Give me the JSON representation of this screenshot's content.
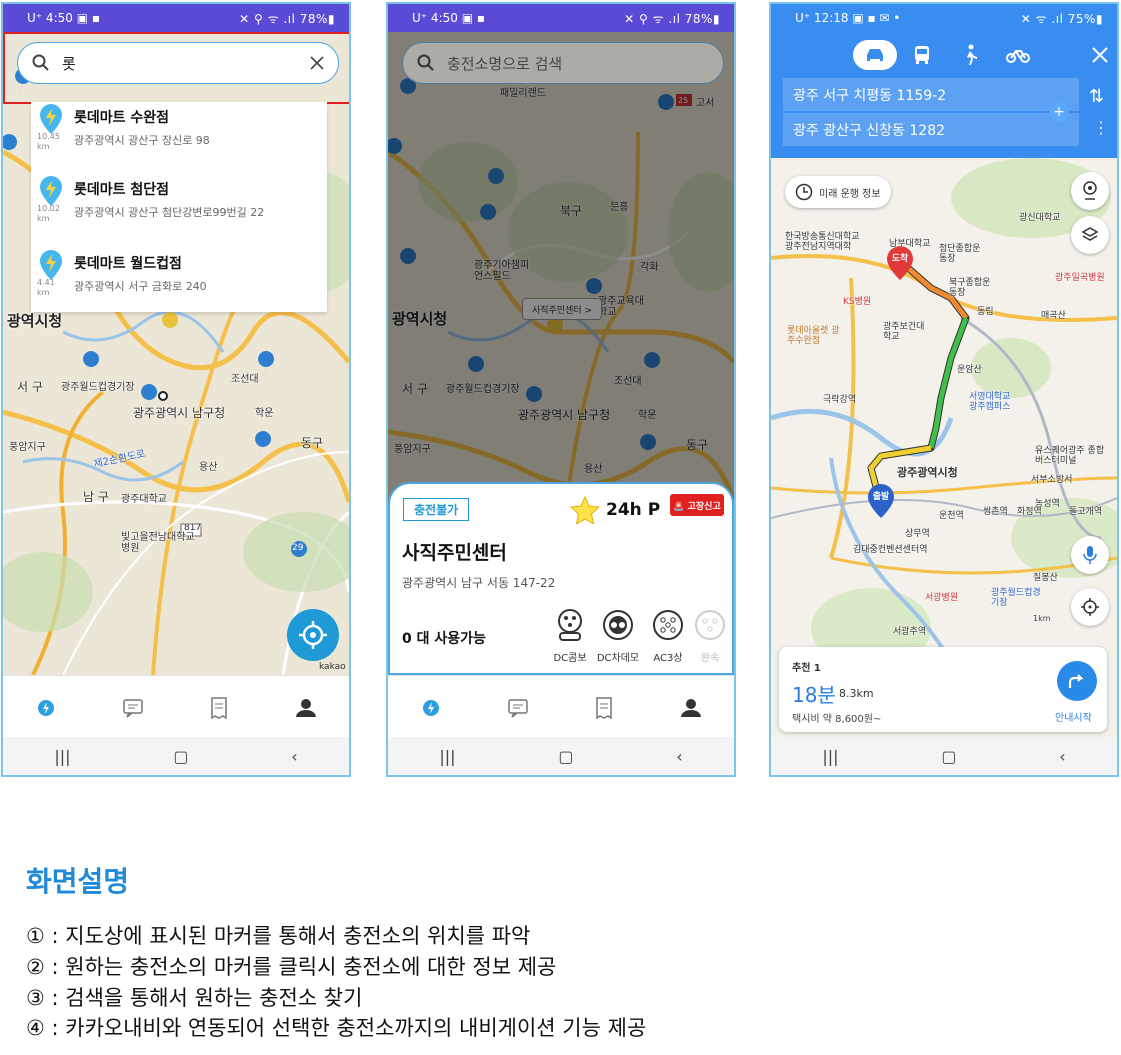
{
  "phone1": {
    "status": {
      "left": "U⁺ 4:50 ▣ ▪",
      "right": "✕ ⚲ ᯤ .ıl 78%▮"
    },
    "search": {
      "query": "롯"
    },
    "suggestions": [
      {
        "name": "롯데마트 수완점",
        "addr": "광주광역시 광산구 장신로 98",
        "dist": "10.45 km"
      },
      {
        "name": "롯데마트 첨단점",
        "addr": "광주광역시 광산구 첨단강변로99번길 22",
        "dist": "10.02 km"
      },
      {
        "name": "롯데마트 월드컵점",
        "addr": "광주광역시 서구 금화로 240",
        "dist": "4.41 km"
      }
    ],
    "map_labels": [
      "광역시청",
      "서 구",
      "광주월드컵경기장",
      "광주광역시 남구청",
      "조선대",
      "학운",
      "풍암지구",
      "동구",
      "용산",
      "남 구",
      "광주대학교",
      "빛고을전남대학교병원",
      "817",
      "29",
      "제2순환도로",
      "kakao"
    ]
  },
  "phone2": {
    "status": {
      "left": "U⁺ 4:50 ▣ ▪",
      "right": "✕ ⚲ ᯤ .ıl 78%▮"
    },
    "search": {
      "placeholder": "충전소명으로 검색"
    },
    "callout": "사직주민센터 >",
    "map_labels": [
      "패밀리랜드",
      "고서",
      "북구",
      "문흥",
      "각화",
      "광주기아챔피언스필드",
      "광주교육대학교",
      "광역시청",
      "서 구",
      "광주월드컵경기장",
      "광주광역시 남구청",
      "조선대",
      "학운",
      "풍암지구",
      "동구",
      "용산",
      "25"
    ],
    "card": {
      "status": "충전불가",
      "hours": "24h",
      "parking": "P",
      "fault": "🚨 고장신고",
      "name": "사직주민센터",
      "address": "광주광역시 남구 서동 147-22",
      "available": "0 대 사용가능",
      "connectors": [
        {
          "label": "DC콤보",
          "enabled": true
        },
        {
          "label": "DC차데모",
          "enabled": true
        },
        {
          "label": "AC3상",
          "enabled": true
        },
        {
          "label": "완속",
          "enabled": false
        }
      ]
    }
  },
  "phone3": {
    "status": {
      "left": "U⁺ 12:18 ▣ ▪ ✉ •",
      "right": "✕ ᯤ .ıl 75%▮"
    },
    "origin": "광주 서구 치평동 1159-2",
    "destination": "광주 광산구 신창동 1282",
    "future_info": "미래 운행 정보",
    "map_labels": [
      "한국방송통신대학교 광주전남지역대학",
      "남부대학교",
      "첨단종합운동장",
      "광신대학교",
      "광주일곡병원",
      "KS병원",
      "롯데아울렛 광주수완점",
      "광주보건대학교",
      "북구종합운동장",
      "동림",
      "매곡산",
      "운암산",
      "서영대학교 광주캠퍼스",
      "극락강역",
      "유스퀘어광주 종합버스터미널",
      "서부소방서",
      "광주광역시청",
      "농성역",
      "돌고개역",
      "상무역",
      "운천역",
      "쌍촌역",
      "화정역",
      "김대중컨벤션센터역",
      "광주월드컵경기장",
      "서광병원",
      "서광주역",
      "질봉산",
      "1km",
      "도착",
      "출발"
    ],
    "route": {
      "label": "추천 1",
      "time": "18분",
      "distance": "8.3km",
      "fare": "택시비 약 8,600원~",
      "start": "안내시작"
    }
  },
  "description": {
    "title": "화면설명",
    "lines": [
      "① : 지도상에 표시된 마커를 통해서 충전소의 위치를 파악",
      "② : 원하는 충전소의 마커를 클릭시 충전소에 대한 정보 제공",
      "③ : 검색을 통해서 원하는 충전소 찾기",
      "④ : 카카오내비와 연동되어 선택한 충전소까지의 내비게이션 기능 제공"
    ]
  },
  "colors": {
    "accent": "#1f9ad6",
    "statusbar": "#5a4bd6",
    "kakao_header": "#3a8df0",
    "highlight": "#e02020"
  }
}
